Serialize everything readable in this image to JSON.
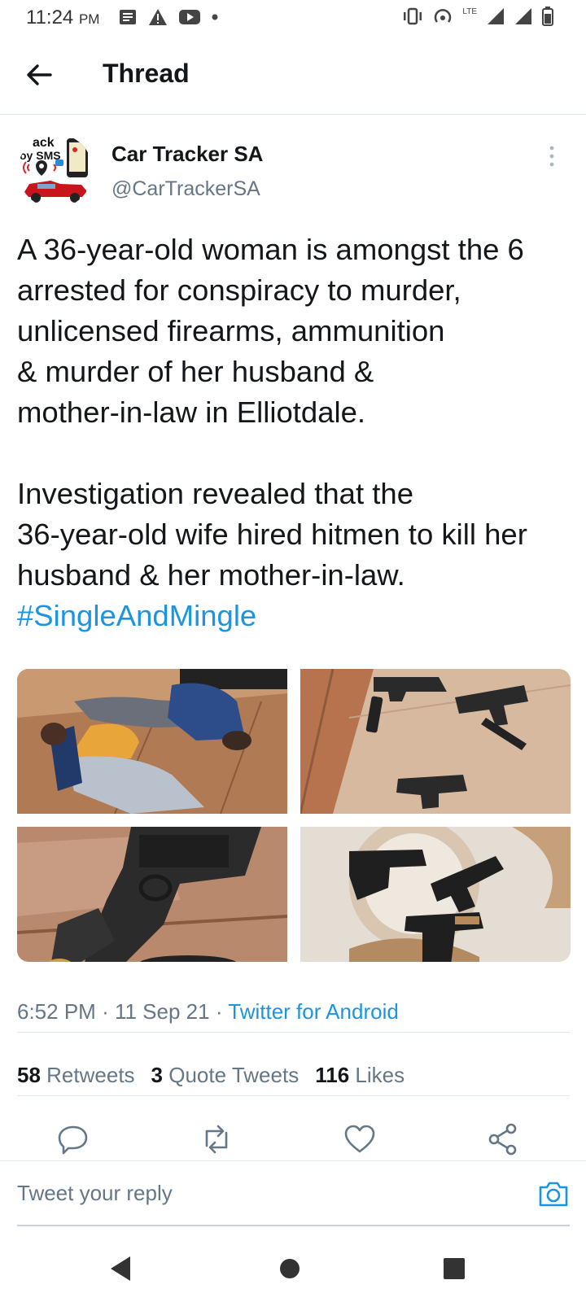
{
  "status_bar": {
    "time": "11:24",
    "ampm": "PM",
    "network": "LTE"
  },
  "header": {
    "title": "Thread"
  },
  "tweet": {
    "author_name": "Car Tracker SA",
    "author_handle": "@CarTrackerSA",
    "avatar_text_top": "ack",
    "avatar_text_bottom": "oy SMS",
    "text": "A 36-year-old woman is amongst the 6 arrested for conspiracy to murder, unlicensed firearms, ammunition\n& murder of her husband &\nmother-in-law in Elliotdale.\n\nInvestigation revealed that the\n36-year-old wife hired hitmen to kill her husband & her mother-in-law.",
    "hashtag": "#SingleAndMingle",
    "time": "6:52 PM",
    "date": "11 Sep 21",
    "separator": "·",
    "source": "Twitter for Android",
    "photos": [
      "men-on-floor-photo",
      "pistols-on-tiles-photo",
      "pistol-closeup-photo",
      "pistols-on-mosaic-photo"
    ]
  },
  "stats": {
    "retweets_count": "58",
    "retweets_label": "Retweets",
    "quotes_count": "3",
    "quotes_label": "Quote Tweets",
    "likes_count": "116",
    "likes_label": "Likes"
  },
  "reply": {
    "placeholder": "Tweet your reply"
  },
  "colors": {
    "accent": "#1b95e0",
    "secondary_text": "#657786",
    "divider": "#e1e8ed"
  }
}
